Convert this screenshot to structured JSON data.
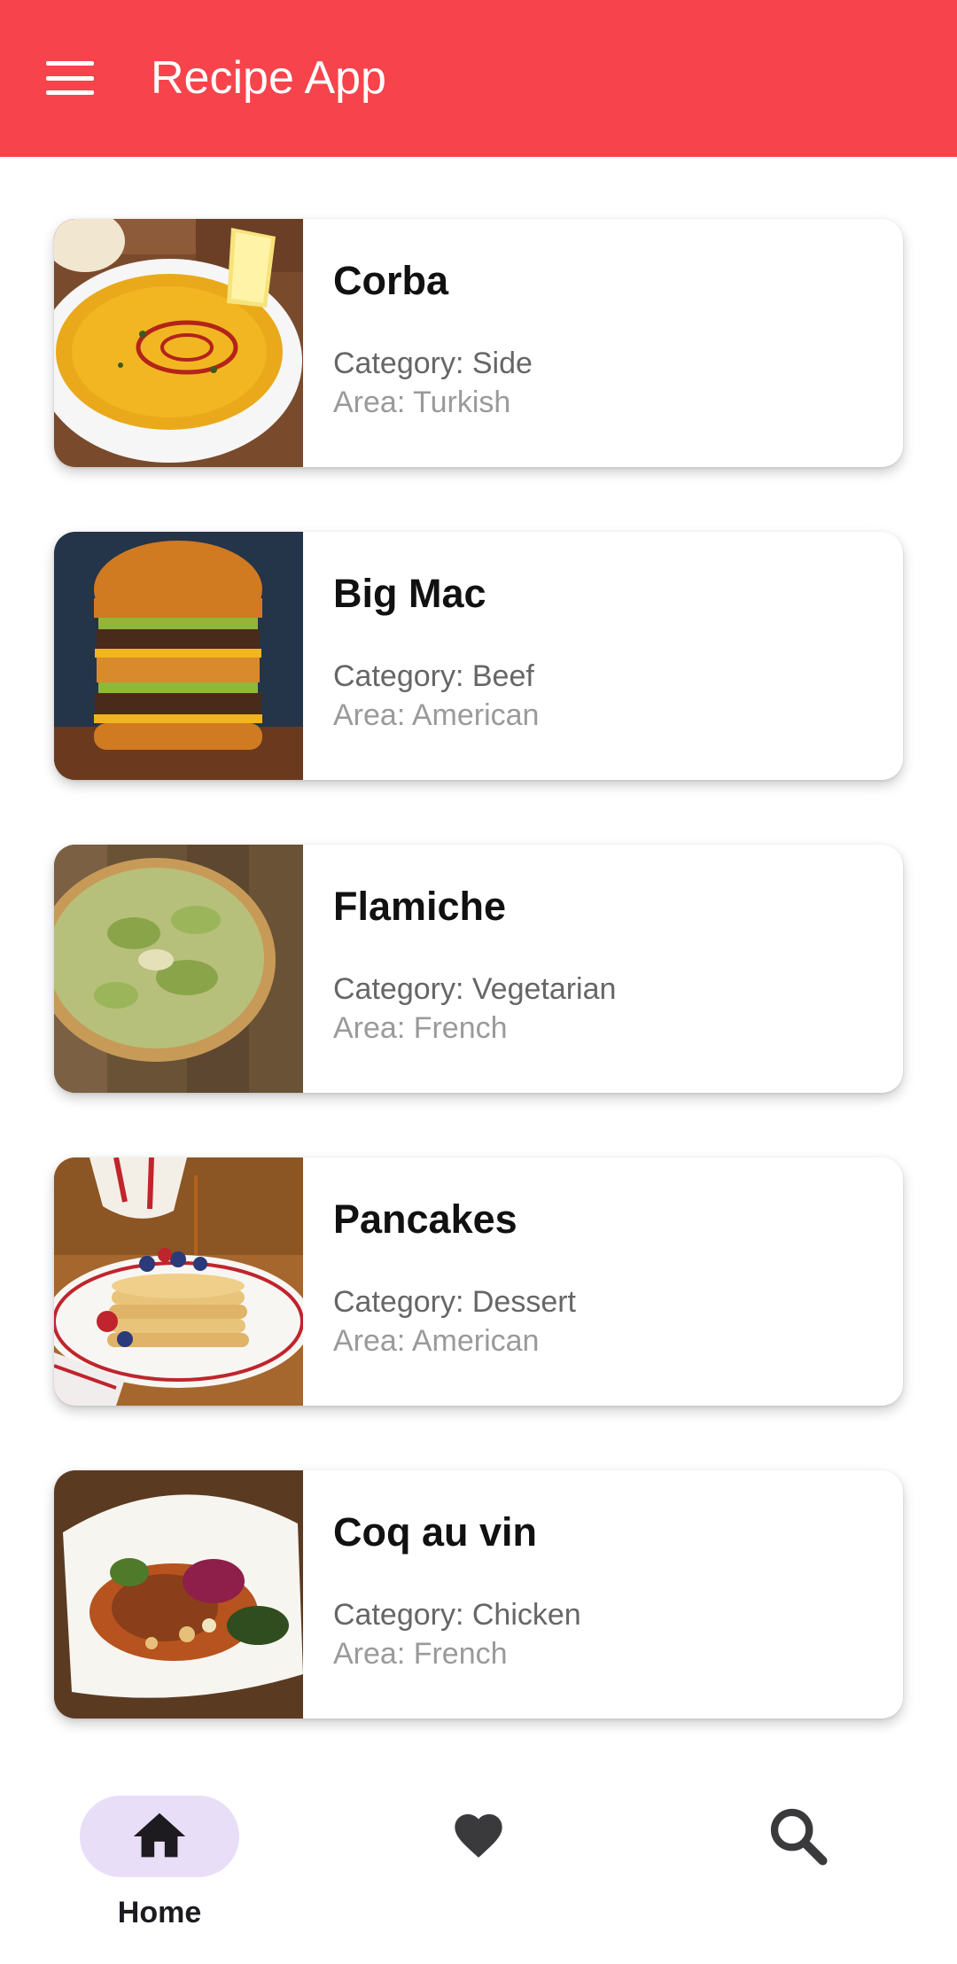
{
  "app": {
    "title": "Recipe App",
    "accent_color": "#f7434b",
    "menu_icon": "hamburger-menu-icon"
  },
  "recipes": [
    {
      "name": "Corba",
      "category": "Category: Side",
      "area": "Area: Turkish",
      "image": "lentil-soup-bowl"
    },
    {
      "name": "Big Mac",
      "category": "Category: Beef",
      "area": "Area: American",
      "image": "double-burger"
    },
    {
      "name": "Flamiche",
      "category": "Category: Vegetarian",
      "area": "Area: French",
      "image": "leek-tart"
    },
    {
      "name": "Pancakes",
      "category": "Category: Dessert",
      "area": "Area: American",
      "image": "pancake-stack"
    },
    {
      "name": "Coq au vin",
      "category": "Category: Chicken",
      "area": "Area: French",
      "image": "chicken-plate"
    }
  ],
  "bottom_nav": {
    "items": [
      {
        "label": "Home",
        "icon": "home-icon",
        "selected": true
      },
      {
        "label": "",
        "icon": "heart-icon",
        "selected": false
      },
      {
        "label": "",
        "icon": "search-icon",
        "selected": false
      }
    ],
    "selected_pill_color": "#e8def8"
  }
}
